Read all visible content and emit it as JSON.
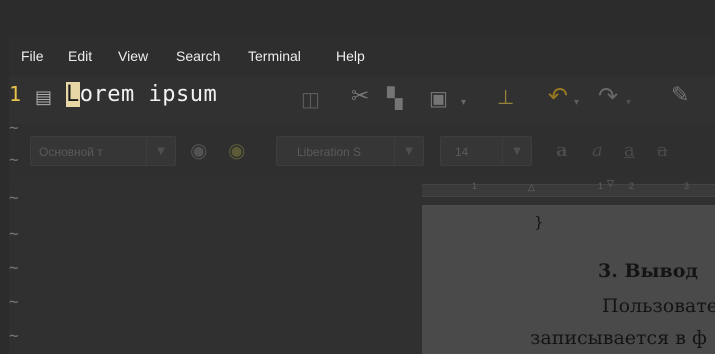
{
  "menubar": {
    "items": [
      "File",
      "Edit",
      "View",
      "Search",
      "Terminal",
      "Help"
    ]
  },
  "vim": {
    "line_number": "1",
    "cursor_char": "L",
    "line_rest": "orem ipsum",
    "empty_line_marker": "~"
  },
  "office": {
    "paragraph_style": "Основной т",
    "font_name": "Liberation S",
    "font_size": "14",
    "ruler_labels": [
      "1",
      "1",
      "2",
      "3"
    ],
    "document": {
      "brace": "}",
      "heading": "3. Вывод",
      "para_line1": "Пользовате",
      "para_line2": "записывается в ф"
    }
  },
  "colors": {
    "line_number": "#e8c24a",
    "cursor_bg": "#e8d7a6",
    "tilde": "#767676",
    "background": "#303030"
  },
  "icons": [
    "document-icon",
    "open-icon",
    "cut-icon",
    "copy-icon",
    "paste-icon",
    "clear-formatting-icon",
    "undo-icon",
    "redo-icon",
    "spellcheck-icon",
    "style-update-icon",
    "style-new-icon"
  ]
}
